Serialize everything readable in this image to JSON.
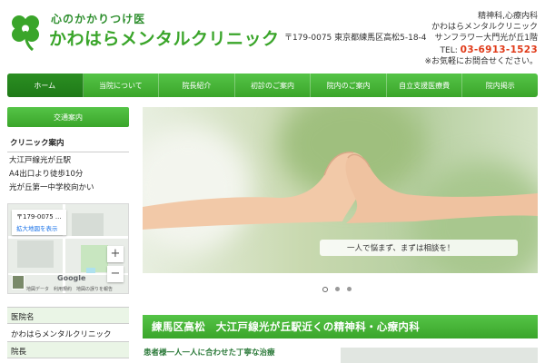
{
  "header": {
    "logo_sub": "心のかかりつけ医",
    "logo_main": "かわはらメンタルクリニック",
    "specialty": "精神科,心療内科",
    "clinic_name": "かわはらメンタルクリニック",
    "address": "〒179-0075 東京都練馬区高松5-18-4　サンフラワー大門光が丘1階",
    "tel_label": "TEL:",
    "tel_number": "03-6913-1523",
    "contact_note": "※お気軽にお問合せください。"
  },
  "nav": {
    "items": [
      "ホーム",
      "当院について",
      "院長紹介",
      "初診のご案内",
      "院内のご案内",
      "自立支援医療費",
      "院内掲示"
    ]
  },
  "sidebar": {
    "access_button": "交通案内",
    "clinic_heading": "クリニック案内",
    "access_lines": [
      "大江戸線光が丘駅",
      "A4出口より徒歩10分",
      "光が丘第一中学校向かい"
    ],
    "map": {
      "card_address": "〒179-0075 ...",
      "card_link": "拡大地図を表示",
      "zoom_in": "+",
      "zoom_out": "−",
      "brand": "Google",
      "footer": "地図データ　利用規約　地図の誤りを報告"
    },
    "table": [
      {
        "label": "医院名",
        "value": "かわはらメンタルクリニック"
      },
      {
        "label": "院長",
        "value": ""
      }
    ]
  },
  "hero": {
    "caption": "一人で悩まず、まずは相談を！",
    "slide_count": 3,
    "active_slide": 1
  },
  "main": {
    "title": "練馬区高松　大江戸線光が丘駅近くの精神科・心療内科",
    "subtitle": "患者様一人一人に合わせた丁寧な治療"
  },
  "colors": {
    "brand_green": "#3aa52a",
    "tel_red": "#e03b1a"
  }
}
